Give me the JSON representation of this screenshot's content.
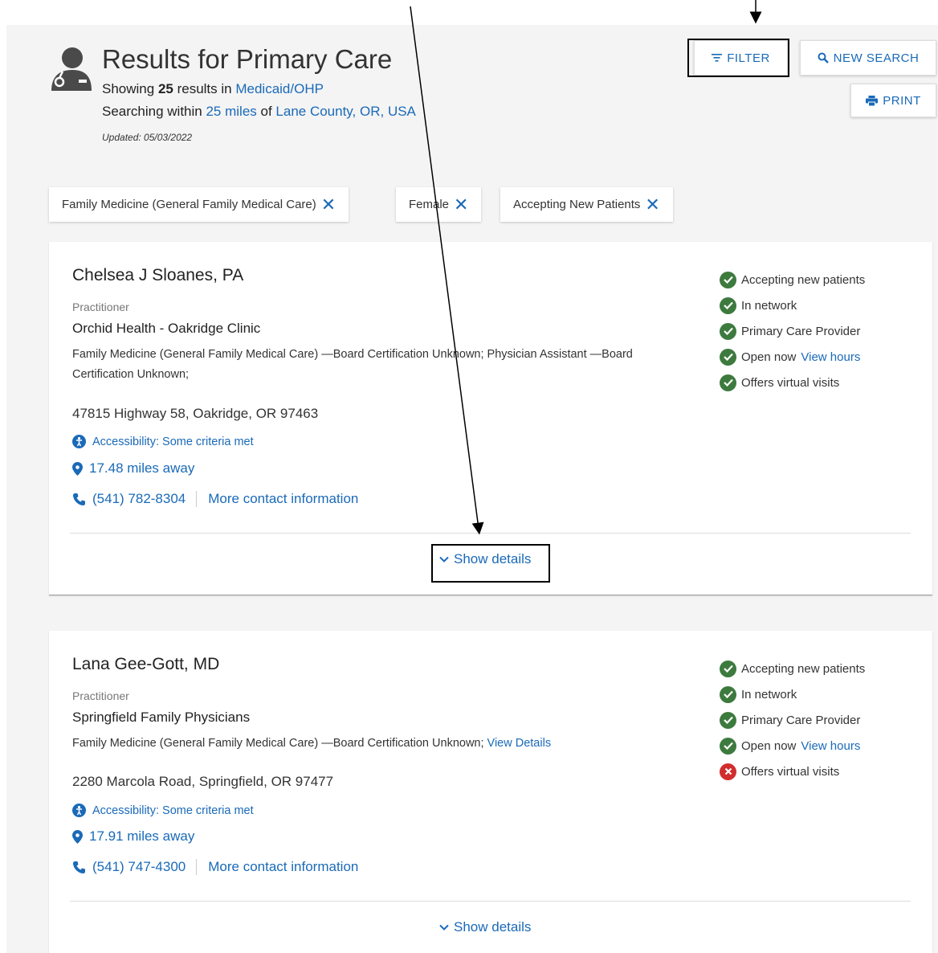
{
  "header": {
    "title": "Results for Primary Care",
    "showing_prefix": "Showing ",
    "result_count": "25",
    "results_in": " results in ",
    "network": "Medicaid/OHP",
    "searching_within": "Searching within ",
    "radius": "25 miles",
    "of": " of ",
    "location": "Lane County, OR, USA",
    "updated": "Updated: 05/03/2022"
  },
  "actions": {
    "filter": "FILTER",
    "new_search": "NEW SEARCH",
    "print": "PRINT"
  },
  "chips": [
    {
      "label": "Family Medicine (General Family Medical Care)"
    },
    {
      "label": "Female"
    },
    {
      "label": "Accepting New Patients"
    }
  ],
  "results": [
    {
      "name": "Chelsea J Sloanes, PA",
      "type": "Practitioner",
      "clinic": "Orchid Health - Oakridge Clinic",
      "specialty": "Family Medicine (General Family Medical Care) —Board Certification Unknown; Physician Assistant —Board Certification Unknown;",
      "specialty_link": "",
      "address": "47815 Highway 58, Oakridge, OR 97463",
      "accessibility": "Accessibility: Some criteria met",
      "distance": "17.48 miles away",
      "phone": "(541) 782-8304",
      "more_contact": "More contact information",
      "show_details": "Show details",
      "badges": [
        {
          "label": "Accepting new patients",
          "ok": true,
          "link": ""
        },
        {
          "label": "In network",
          "ok": true,
          "link": ""
        },
        {
          "label": "Primary Care Provider",
          "ok": true,
          "link": ""
        },
        {
          "label": "Open now",
          "ok": true,
          "link": "View hours"
        },
        {
          "label": "Offers virtual visits",
          "ok": true,
          "link": ""
        }
      ]
    },
    {
      "name": "Lana Gee-Gott, MD",
      "type": "Practitioner",
      "clinic": "Springfield Family Physicians",
      "specialty": "Family Medicine (General Family Medical Care) —Board Certification Unknown;",
      "specialty_link": "View Details",
      "address": "2280 Marcola Road, Springfield, OR 97477",
      "accessibility": "Accessibility: Some criteria met",
      "distance": "17.91 miles away",
      "phone": "(541) 747-4300",
      "more_contact": "More contact information",
      "show_details": "Show details",
      "badges": [
        {
          "label": "Accepting new patients",
          "ok": true,
          "link": ""
        },
        {
          "label": "In network",
          "ok": true,
          "link": ""
        },
        {
          "label": "Primary Care Provider",
          "ok": true,
          "link": ""
        },
        {
          "label": "Open now",
          "ok": true,
          "link": "View hours"
        },
        {
          "label": "Offers virtual visits",
          "ok": false,
          "link": ""
        }
      ]
    }
  ],
  "colors": {
    "link": "#1a6ab8",
    "check": "#3d7a3e",
    "cross": "#d22d2d",
    "page_bg": "#f4f4f4"
  }
}
